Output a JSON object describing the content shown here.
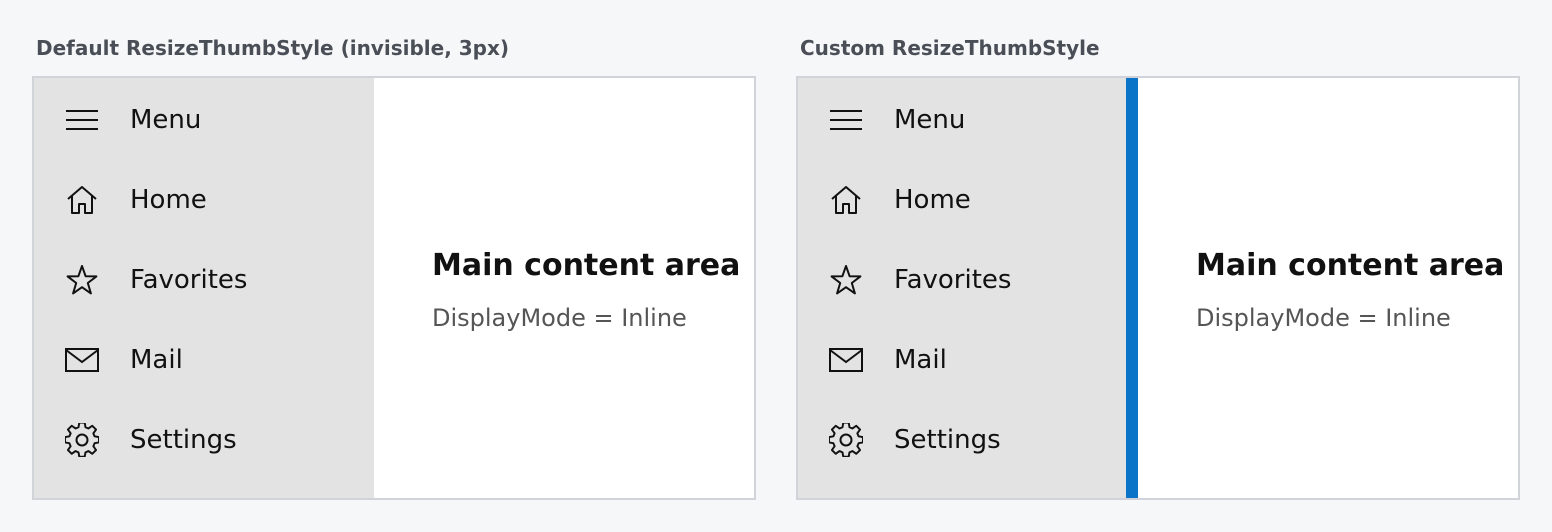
{
  "panels": [
    {
      "title": "Default ResizeThumbStyle (invisible, 3px)",
      "nav_items": [
        {
          "label": "Menu",
          "icon": "hamburger-icon"
        },
        {
          "label": "Home",
          "icon": "home-icon"
        },
        {
          "label": "Favorites",
          "icon": "star-icon"
        },
        {
          "label": "Mail",
          "icon": "mail-icon"
        },
        {
          "label": "Settings",
          "icon": "gear-icon"
        }
      ],
      "main_title": "Main content area",
      "main_subtitle": "DisplayMode = Inline"
    },
    {
      "title": "Custom ResizeThumbStyle",
      "nav_items": [
        {
          "label": "Menu",
          "icon": "hamburger-icon"
        },
        {
          "label": "Home",
          "icon": "home-icon"
        },
        {
          "label": "Favorites",
          "icon": "star-icon"
        },
        {
          "label": "Mail",
          "icon": "mail-icon"
        },
        {
          "label": "Settings",
          "icon": "gear-icon"
        }
      ],
      "main_title": "Main content area",
      "main_subtitle": "DisplayMode = Inline",
      "resize_thumb_color": "#0a74c8"
    }
  ],
  "colors": {
    "pane_background": "#e3e3e3",
    "content_background": "#ffffff",
    "page_background": "#f6f7f9",
    "frame_border": "#d0d3d8"
  }
}
